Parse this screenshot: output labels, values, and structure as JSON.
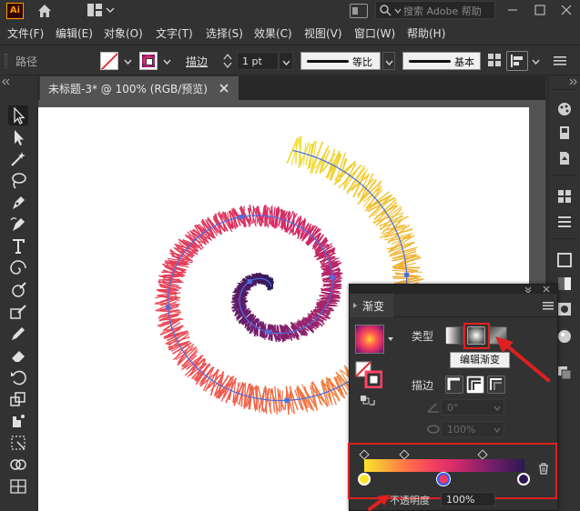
{
  "app": {
    "logo_text": "Ai",
    "search_placeholder": "搜索 Adobe 帮助"
  },
  "menu": {
    "items": [
      "文件(F)",
      "编辑(E)",
      "对象(O)",
      "文字(T)",
      "选择(S)",
      "效果(C)",
      "视图(V)",
      "窗口(W)",
      "帮助(H)"
    ]
  },
  "control_bar": {
    "selection_label": "路径",
    "stroke_label": "描边",
    "stroke_weight": "1 pt",
    "profile_uniform": "等比",
    "brush_basic": "基本"
  },
  "document": {
    "tab_title": "未标题-3* @ 100% (RGB/预览)"
  },
  "gradient_panel": {
    "tab_label": "渐变",
    "type_label": "类型",
    "edit_gradient_tooltip": "编辑渐变",
    "stroke_label": "描边",
    "angle_value": "0°",
    "aspect_value": "100%",
    "opacity_label": "不透明度",
    "opacity_value": "100%",
    "gradient_type": "radial"
  },
  "colors": {
    "ui_dark": "#323232",
    "canvas_bg": "#535353",
    "annotation_red": "#e02020",
    "spiral_path": "#4a6fe0",
    "gradient_stops": [
      "#fde32a",
      "#ef3b63",
      "#2b1854"
    ]
  }
}
